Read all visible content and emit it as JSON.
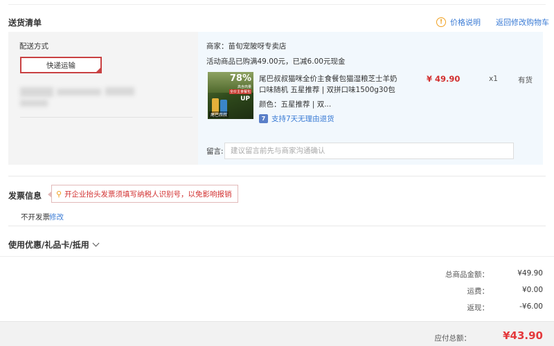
{
  "delivery_list": {
    "title": "送货清单",
    "price_help": "价格说明",
    "back_to_cart": "返回修改购物车",
    "delivery_method_label": "配送方式",
    "delivery_method": "快递运输"
  },
  "order": {
    "shop": "商家：苗旬宠陂呀专卖店",
    "promo": "活动商品已购满49.00元，已减6.00元现金",
    "product": {
      "thumb_percent": "78%",
      "thumb_line1": "高含肉量",
      "thumb_line2": "全价主食餐包",
      "thumb_up": "UP",
      "thumb_brand": "尾巴叔叔",
      "title": "尾巴叔叔猫咪全价主食餐包猫湿粮芝士羊奶口味随机 五星推荐 | 双拼口味1500g30包",
      "price": "¥ 49.90",
      "qty": "x1",
      "stock": "有货",
      "color": "颜色：五星推荐 | 双...",
      "return_policy": "支持7天无理由退货",
      "return_icon": "7"
    },
    "message_label": "留言:",
    "message_placeholder": "建议留言前先与商家沟通确认"
  },
  "invoice": {
    "title": "发票信息",
    "tip": "开企业抬头发票须填写纳税人识别号，以免影响报销",
    "state": "不开发票",
    "edit": "修改"
  },
  "coupon": {
    "label": "使用优惠/礼品卡/抵用"
  },
  "summary": {
    "goods_total_label": "总商品金额：",
    "goods_total": "¥49.90",
    "shipping_label": "运费：",
    "shipping": "¥0.00",
    "rebate_label": "返现：",
    "rebate": "-¥6.00",
    "payable_label": "应付总额：",
    "payable": "¥43.90"
  },
  "colors": {
    "accent_red": "#e4393c",
    "link_blue": "#3a7bd5",
    "delivery_border": "#c94142"
  },
  "icons": {
    "price_help": "info-icon",
    "invoice_tip": "lightbulb-icon",
    "return": "seven-day-return-icon",
    "coupon_toggle": "chevron-down-icon"
  }
}
